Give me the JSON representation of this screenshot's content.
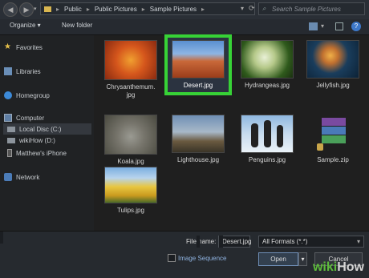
{
  "address": {
    "breadcrumb": [
      "Public",
      "Public Pictures",
      "Sample Pictures"
    ],
    "search_placeholder": "Search Sample Pictures"
  },
  "toolbar": {
    "organize": "Organize ▾",
    "new_folder": "New folder"
  },
  "sidebar": {
    "favorites": "Favorites",
    "libraries": "Libraries",
    "homegroup": "Homegroup",
    "computer": "Computer",
    "local_disc": "Local Disc (C:)",
    "wikihow": "wikiHow (D:)",
    "iphone": "Matthew's iPhone",
    "network": "Network"
  },
  "files": [
    {
      "name": "Chrysanthemum.jpg",
      "line1": "Chrysanthemum.",
      "line2": "jpg"
    },
    {
      "name": "Desert.jpg",
      "line1": "Desert.jpg",
      "line2": ""
    },
    {
      "name": "Hydrangeas.jpg",
      "line1": "Hydrangeas.jpg",
      "line2": ""
    },
    {
      "name": "Jellyfish.jpg",
      "line1": "Jellyfish.jpg",
      "line2": ""
    },
    {
      "name": "Koala.jpg",
      "line1": "Koala.jpg",
      "line2": ""
    },
    {
      "name": "Lighthouse.jpg",
      "line1": "Lighthouse.jpg",
      "line2": ""
    },
    {
      "name": "Penguins.jpg",
      "line1": "Penguins.jpg",
      "line2": ""
    },
    {
      "name": "Sample.zip",
      "line1": "Sample.zip",
      "line2": ""
    },
    {
      "name": "Tulips.jpg",
      "line1": "Tulips.jpg",
      "line2": ""
    }
  ],
  "bottom": {
    "file_name_label": "File name:",
    "file_name_value": "Desert.jpg",
    "format_value": "All Formats (*.*)",
    "image_sequence": "Image Sequence",
    "open": "Open",
    "cancel": "Cancel"
  },
  "watermark": {
    "wiki": "wiki",
    "how": "How"
  },
  "colors": {
    "selection_border": "#37d236"
  }
}
